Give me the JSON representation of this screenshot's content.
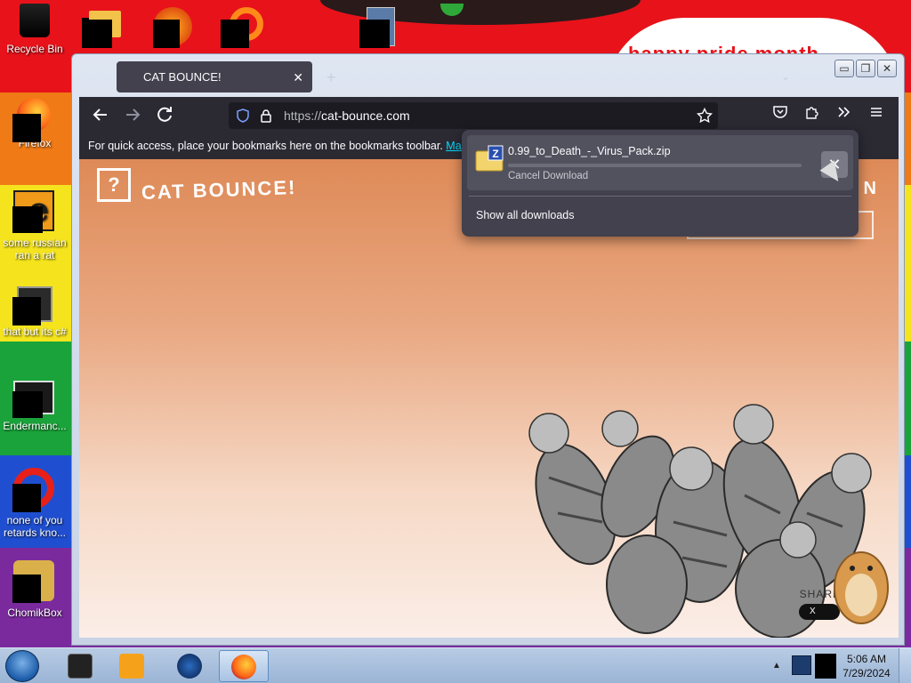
{
  "desktop": {
    "wallpaper_text": "happy pride month",
    "icons": [
      {
        "label": "Recycle Bin",
        "icon": "recycle-bin-icon"
      },
      {
        "label": "Firefox",
        "icon": "firefox-icon"
      },
      {
        "label": "some russian ran a rat",
        "icon": "e-folder-icon"
      },
      {
        "label": "that but its c#",
        "icon": "stacked-windows-icon"
      },
      {
        "label": "Endermanc...",
        "icon": "terminal-icon"
      },
      {
        "label": "none of you retards kno...",
        "icon": "red-ring-icon"
      },
      {
        "label": "ChomikBox",
        "icon": "hamster-box-icon"
      }
    ]
  },
  "browser": {
    "tab_title": "CAT BOUNCE!",
    "tab_close": "✕",
    "new_tab": "+",
    "list_all_tabs": "⌄",
    "url_protocol": "https://",
    "url_host": "cat-bounce.com",
    "bookmarks_notice": "For quick access, place your bookmarks here on the bookmarks toolbar.",
    "bookmarks_manage": "Manage",
    "window_controls": {
      "minimize": "▭",
      "restore": "❐",
      "close": "✕"
    }
  },
  "page": {
    "logo_glyph": "?",
    "logo_text": "CAT BOUNCE!",
    "side_letter": "N",
    "share_label": "SHARE",
    "share_x_button": "X"
  },
  "downloads": {
    "file_name": "0.99_to_Death_-_Virus_Pack.zip",
    "file_icon_letter": "Z",
    "status": "Cancel Download",
    "cancel_glyph": "✕",
    "show_all": "Show all downloads",
    "progress": 0
  },
  "taskbar": {
    "clock_time": "5:06 AM",
    "clock_date": "7/29/2024",
    "tray_up": "▲"
  },
  "colors": {
    "firefox_toolbar": "#2b2a33",
    "urlbar": "#1c1b22",
    "download_panel": "#42414d",
    "link": "#00ddff",
    "taskbar": "#a8c0de"
  }
}
